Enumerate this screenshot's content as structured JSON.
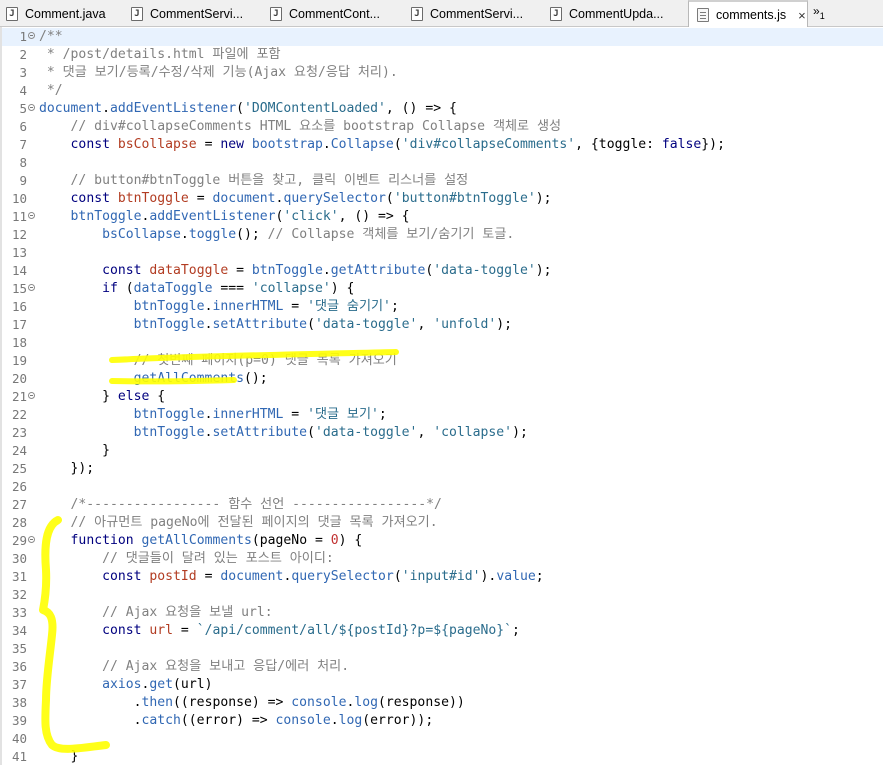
{
  "tabs": [
    {
      "label": "Comment.java",
      "icon": "java-file-icon",
      "active": false
    },
    {
      "label": "CommentServi...",
      "icon": "java-file-icon",
      "active": false
    },
    {
      "label": "CommentCont...",
      "icon": "java-file-icon",
      "active": false
    },
    {
      "label": "CommentServi...",
      "icon": "java-file-icon",
      "active": false
    },
    {
      "label": "CommentUpda...",
      "icon": "java-file-icon",
      "active": false
    },
    {
      "label": "comments.js",
      "icon": "js-file-icon",
      "active": true
    }
  ],
  "tab_close_glyph": "×",
  "overflow": {
    "glyph": "»",
    "count": "1"
  },
  "highlight_color": "#ffff00",
  "current_line": 1,
  "lines": [
    {
      "n": "1",
      "fold": true,
      "tokens": [
        [
          "cm",
          "/**"
        ]
      ]
    },
    {
      "n": "2",
      "tokens": [
        [
          "cm",
          " * /post/details.html 파일에 포함"
        ]
      ]
    },
    {
      "n": "3",
      "tokens": [
        [
          "cm",
          " * 댓글 보기/등록/수정/삭제 기능(Ajax 요청/응답 처리)."
        ]
      ]
    },
    {
      "n": "4",
      "tokens": [
        [
          "cm",
          " */"
        ]
      ]
    },
    {
      "n": "5",
      "fold": true,
      "tokens": [
        [
          "fn",
          "document"
        ],
        [
          "pl",
          "."
        ],
        [
          "fn",
          "addEventListener"
        ],
        [
          "pl",
          "("
        ],
        [
          "st",
          "'DOMContentLoaded'"
        ],
        [
          "pl",
          ", () => {"
        ]
      ]
    },
    {
      "n": "6",
      "tokens": [
        [
          "cm",
          "    // div#collapseComments HTML 요소를 bootstrap Collapse 객체로 생성"
        ]
      ]
    },
    {
      "n": "7",
      "tokens": [
        [
          "pl",
          "    "
        ],
        [
          "kw",
          "const"
        ],
        [
          "pl",
          " "
        ],
        [
          "vr",
          "bsCollapse"
        ],
        [
          "pl",
          " = "
        ],
        [
          "kw",
          "new"
        ],
        [
          "pl",
          " "
        ],
        [
          "fn",
          "bootstrap"
        ],
        [
          "pl",
          "."
        ],
        [
          "fn",
          "Collapse"
        ],
        [
          "pl",
          "("
        ],
        [
          "st",
          "'div#collapseComments'"
        ],
        [
          "pl",
          ", {toggle: "
        ],
        [
          "kw",
          "false"
        ],
        [
          "pl",
          "});"
        ]
      ]
    },
    {
      "n": "8",
      "tokens": []
    },
    {
      "n": "9",
      "tokens": [
        [
          "cm",
          "    // button#btnToggle 버튼을 찾고, 클릭 이벤트 리스너를 설정"
        ]
      ]
    },
    {
      "n": "10",
      "tokens": [
        [
          "pl",
          "    "
        ],
        [
          "kw",
          "const"
        ],
        [
          "pl",
          " "
        ],
        [
          "vr",
          "btnToggle"
        ],
        [
          "pl",
          " = "
        ],
        [
          "fn",
          "document"
        ],
        [
          "pl",
          "."
        ],
        [
          "fn",
          "querySelector"
        ],
        [
          "pl",
          "("
        ],
        [
          "st",
          "'button#btnToggle'"
        ],
        [
          "pl",
          ");"
        ]
      ]
    },
    {
      "n": "11",
      "fold": true,
      "tokens": [
        [
          "pl",
          "    "
        ],
        [
          "fn",
          "btnToggle"
        ],
        [
          "pl",
          "."
        ],
        [
          "fn",
          "addEventListener"
        ],
        [
          "pl",
          "("
        ],
        [
          "st",
          "'click'"
        ],
        [
          "pl",
          ", () => {"
        ]
      ]
    },
    {
      "n": "12",
      "tokens": [
        [
          "pl",
          "        "
        ],
        [
          "fn",
          "bsCollapse"
        ],
        [
          "pl",
          "."
        ],
        [
          "fn",
          "toggle"
        ],
        [
          "pl",
          "(); "
        ],
        [
          "cm",
          "// Collapse 객체를 보기/숨기기 토글."
        ]
      ]
    },
    {
      "n": "13",
      "tokens": []
    },
    {
      "n": "14",
      "tokens": [
        [
          "pl",
          "        "
        ],
        [
          "kw",
          "const"
        ],
        [
          "pl",
          " "
        ],
        [
          "vr",
          "dataToggle"
        ],
        [
          "pl",
          " = "
        ],
        [
          "fn",
          "btnToggle"
        ],
        [
          "pl",
          "."
        ],
        [
          "fn",
          "getAttribute"
        ],
        [
          "pl",
          "("
        ],
        [
          "st",
          "'data-toggle'"
        ],
        [
          "pl",
          ");"
        ]
      ]
    },
    {
      "n": "15",
      "fold": true,
      "tokens": [
        [
          "pl",
          "        "
        ],
        [
          "kw",
          "if"
        ],
        [
          "pl",
          " ("
        ],
        [
          "fn",
          "dataToggle"
        ],
        [
          "pl",
          " === "
        ],
        [
          "st",
          "'collapse'"
        ],
        [
          "pl",
          ") {"
        ]
      ]
    },
    {
      "n": "16",
      "tokens": [
        [
          "pl",
          "            "
        ],
        [
          "fn",
          "btnToggle"
        ],
        [
          "pl",
          "."
        ],
        [
          "fn",
          "innerHTML"
        ],
        [
          "pl",
          " = "
        ],
        [
          "st",
          "'댓글 숨기기'"
        ],
        [
          "pl",
          ";"
        ]
      ]
    },
    {
      "n": "17",
      "tokens": [
        [
          "pl",
          "            "
        ],
        [
          "fn",
          "btnToggle"
        ],
        [
          "pl",
          "."
        ],
        [
          "fn",
          "setAttribute"
        ],
        [
          "pl",
          "("
        ],
        [
          "st",
          "'data-toggle'"
        ],
        [
          "pl",
          ", "
        ],
        [
          "st",
          "'unfold'"
        ],
        [
          "pl",
          ");"
        ]
      ]
    },
    {
      "n": "18",
      "tokens": []
    },
    {
      "n": "19",
      "tokens": [
        [
          "cm",
          "            // 첫번째 페이지(p=0) 댓글 목록 가져오기"
        ]
      ]
    },
    {
      "n": "20",
      "tokens": [
        [
          "pl",
          "            "
        ],
        [
          "fn",
          "getAllComments"
        ],
        [
          "pl",
          "();"
        ]
      ]
    },
    {
      "n": "21",
      "fold": true,
      "tokens": [
        [
          "pl",
          "        } "
        ],
        [
          "kw",
          "else"
        ],
        [
          "pl",
          " {"
        ]
      ]
    },
    {
      "n": "22",
      "tokens": [
        [
          "pl",
          "            "
        ],
        [
          "fn",
          "btnToggle"
        ],
        [
          "pl",
          "."
        ],
        [
          "fn",
          "innerHTML"
        ],
        [
          "pl",
          " = "
        ],
        [
          "st",
          "'댓글 보기'"
        ],
        [
          "pl",
          ";"
        ]
      ]
    },
    {
      "n": "23",
      "tokens": [
        [
          "pl",
          "            "
        ],
        [
          "fn",
          "btnToggle"
        ],
        [
          "pl",
          "."
        ],
        [
          "fn",
          "setAttribute"
        ],
        [
          "pl",
          "("
        ],
        [
          "st",
          "'data-toggle'"
        ],
        [
          "pl",
          ", "
        ],
        [
          "st",
          "'collapse'"
        ],
        [
          "pl",
          ");"
        ]
      ]
    },
    {
      "n": "24",
      "tokens": [
        [
          "pl",
          "        }"
        ]
      ]
    },
    {
      "n": "25",
      "tokens": [
        [
          "pl",
          "    });"
        ]
      ]
    },
    {
      "n": "26",
      "tokens": []
    },
    {
      "n": "27",
      "tokens": [
        [
          "cm",
          "    /*----------------- 함수 선언 -----------------*/"
        ]
      ]
    },
    {
      "n": "28",
      "tokens": [
        [
          "cm",
          "    // 아규먼트 pageNo에 전달된 페이지의 댓글 목록 가져오기."
        ]
      ]
    },
    {
      "n": "29",
      "fold": true,
      "tokens": [
        [
          "pl",
          "    "
        ],
        [
          "kw",
          "function"
        ],
        [
          "pl",
          " "
        ],
        [
          "fn",
          "getAllComments"
        ],
        [
          "pl",
          "(pageNo = "
        ],
        [
          "nm",
          "0"
        ],
        [
          "pl",
          ") {"
        ]
      ]
    },
    {
      "n": "30",
      "tokens": [
        [
          "cm",
          "        // 댓글들이 달려 있는 포스트 아이디:"
        ]
      ]
    },
    {
      "n": "31",
      "tokens": [
        [
          "pl",
          "        "
        ],
        [
          "kw",
          "const"
        ],
        [
          "pl",
          " "
        ],
        [
          "vr",
          "postId"
        ],
        [
          "pl",
          " = "
        ],
        [
          "fn",
          "document"
        ],
        [
          "pl",
          "."
        ],
        [
          "fn",
          "querySelector"
        ],
        [
          "pl",
          "("
        ],
        [
          "st",
          "'input#id'"
        ],
        [
          "pl",
          ")."
        ],
        [
          "fn",
          "value"
        ],
        [
          "pl",
          ";"
        ]
      ]
    },
    {
      "n": "32",
      "tokens": []
    },
    {
      "n": "33",
      "tokens": [
        [
          "cm",
          "        // Ajax 요청을 보낼 url:"
        ]
      ]
    },
    {
      "n": "34",
      "tokens": [
        [
          "pl",
          "        "
        ],
        [
          "kw",
          "const"
        ],
        [
          "pl",
          " "
        ],
        [
          "vr",
          "url"
        ],
        [
          "pl",
          " = "
        ],
        [
          "st",
          "`/api/comment/all/${postId}?p=${pageNo}`"
        ],
        [
          "pl",
          ";"
        ]
      ]
    },
    {
      "n": "35",
      "tokens": []
    },
    {
      "n": "36",
      "tokens": [
        [
          "cm",
          "        // Ajax 요청을 보내고 응답/에러 처리."
        ]
      ]
    },
    {
      "n": "37",
      "tokens": [
        [
          "pl",
          "        "
        ],
        [
          "fn",
          "axios"
        ],
        [
          "pl",
          "."
        ],
        [
          "fn",
          "get"
        ],
        [
          "pl",
          "(url)"
        ]
      ]
    },
    {
      "n": "38",
      "tokens": [
        [
          "pl",
          "            ."
        ],
        [
          "fn",
          "then"
        ],
        [
          "pl",
          "((response) => "
        ],
        [
          "fn",
          "console"
        ],
        [
          "pl",
          "."
        ],
        [
          "fn",
          "log"
        ],
        [
          "pl",
          "(response))"
        ]
      ]
    },
    {
      "n": "39",
      "tokens": [
        [
          "pl",
          "            ."
        ],
        [
          "fn",
          "catch"
        ],
        [
          "pl",
          "((error) => "
        ],
        [
          "fn",
          "console"
        ],
        [
          "pl",
          "."
        ],
        [
          "fn",
          "log"
        ],
        [
          "pl",
          "(error));"
        ]
      ]
    },
    {
      "n": "40",
      "tokens": []
    },
    {
      "n": "41",
      "tokens": [
        [
          "pl",
          "    }"
        ]
      ]
    }
  ]
}
